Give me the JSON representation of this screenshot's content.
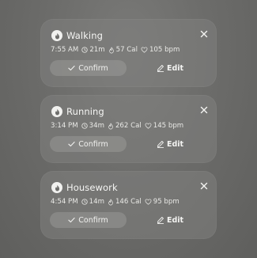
{
  "cards": [
    {
      "activity": "Walking",
      "activity_icon": "flame-icon",
      "time": "7:55 AM",
      "duration": "21m",
      "calories": "57 Cal",
      "heart_rate": "105 bpm",
      "confirm_label": "Confirm",
      "edit_label": "Edit"
    },
    {
      "activity": "Running",
      "activity_icon": "flame-icon",
      "time": "3:14 PM",
      "duration": "34m",
      "calories": "262 Cal",
      "heart_rate": "145 bpm",
      "confirm_label": "Confirm",
      "edit_label": "Edit"
    },
    {
      "activity": "Housework",
      "activity_icon": "flame-icon",
      "time": "4:54 PM",
      "duration": "14m",
      "calories": "146 Cal",
      "heart_rate": "95 bpm",
      "confirm_label": "Confirm",
      "edit_label": "Edit"
    }
  ],
  "colors": {
    "card_background": "#80807e",
    "text": "#f3f3f1",
    "confirm_button": "#a0a09d"
  }
}
